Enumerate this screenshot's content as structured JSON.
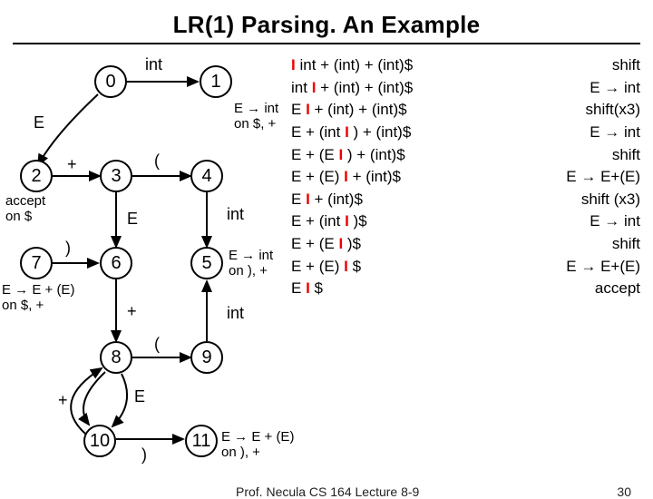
{
  "title": "LR(1) Parsing. An Example",
  "footer": {
    "center": "Prof. Necula  CS 164  Lecture 8-9",
    "slide": "30"
  },
  "nodes": {
    "n0": "0",
    "n1": "1",
    "n2": "2",
    "n3": "3",
    "n4": "4",
    "n5": "5",
    "n6": "6",
    "n7": "7",
    "n8": "8",
    "n9": "9",
    "n10": "10",
    "n11": "11"
  },
  "edge_labels": {
    "e0_1": "int",
    "e0_2_left": "E",
    "e2_3": "+",
    "e3_4": "(",
    "e3_6_below": "E",
    "e4_5_right": "int",
    "e7_6": ")",
    "e6_8_below": "+",
    "e8_9": "(",
    "e8_10_left": "+",
    "e8_10_mid": "E",
    "e10_11": ")",
    "e9_5_right": "int"
  },
  "annot": {
    "accept": "accept\non $",
    "e_int_dp": "E → int\non $, +",
    "e_int_rp": "E → int\non ), +",
    "e_eplus_dp": "E → E + (E)\non $, +",
    "e_eplus_rp": "E → E + (E)\non ), +"
  },
  "trace": [
    {
      "cfg": "| int + (int) + (int)$",
      "action": "shift"
    },
    {
      "cfg": "int | + (int) + (int)$",
      "action": "E → int"
    },
    {
      "cfg": "E | + (int) + (int)$",
      "action": "shift(x3)"
    },
    {
      "cfg": "E + (int | ) + (int)$",
      "action": "E → int"
    },
    {
      "cfg": "E + (E | ) + (int)$",
      "action": "shift"
    },
    {
      "cfg": "E + (E) | + (int)$",
      "action": "E → E+(E)"
    },
    {
      "cfg": "E | + (int)$",
      "action": "shift (x3)"
    },
    {
      "cfg": "E + (int | )$",
      "action": "E → int"
    },
    {
      "cfg": "E + (E | )$",
      "action": "shift"
    },
    {
      "cfg": "E + (E) | $",
      "action": "E → E+(E)"
    },
    {
      "cfg": "E | $",
      "action": "accept"
    }
  ]
}
